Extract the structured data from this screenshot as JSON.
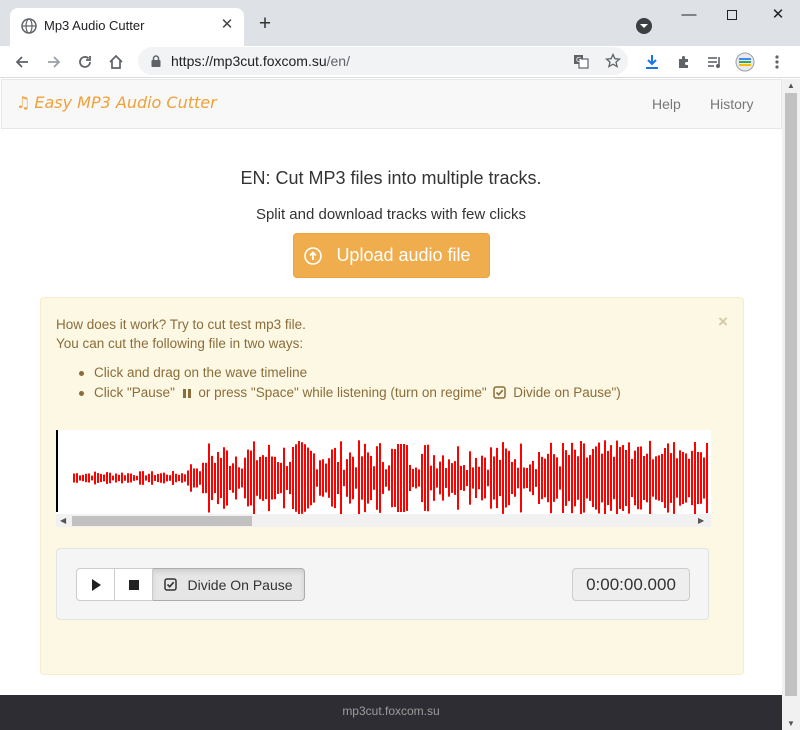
{
  "browser": {
    "tab_title": "Mp3 Audio Cutter",
    "new_tab": "+",
    "url_base": "https://mp3cut.foxcom.su",
    "url_path": "/en/",
    "icons": [
      "globe-icon",
      "close-icon",
      "back-icon",
      "forward-icon",
      "reload-icon",
      "home-icon",
      "lock-icon",
      "translate-icon",
      "star-icon",
      "download-icon",
      "extensions-icon",
      "media-icon",
      "profile-icon",
      "menu-icon"
    ]
  },
  "site": {
    "brand": "Easy MP3 Audio Cutter",
    "brand_icon": "music-note-icon",
    "nav": {
      "help": "Help",
      "history": "History"
    },
    "brand_color": "#f0a038"
  },
  "main": {
    "headline": "EN: Cut MP3 files into multiple tracks.",
    "subline": "Split and download tracks with few clicks",
    "upload_label": "Upload audio file",
    "accent_color": "#f0ad4e"
  },
  "alert": {
    "close": "×",
    "line1": "How does it work? Try to cut test mp3 file.",
    "line2": "You can cut the following file in two ways:",
    "item1": "Click and drag on the wave timeline",
    "item2_a": "Click \"Pause\"",
    "item2_b": "or press \"Space\" while listening (turn on regime\"",
    "item2_c": "Divide on Pause\")",
    "wave_color": "#ff0000"
  },
  "player": {
    "divide_label": "Divide On Pause",
    "time": "0:00:00.000"
  },
  "footer": {
    "text": "mp3cut.foxcom.su"
  }
}
